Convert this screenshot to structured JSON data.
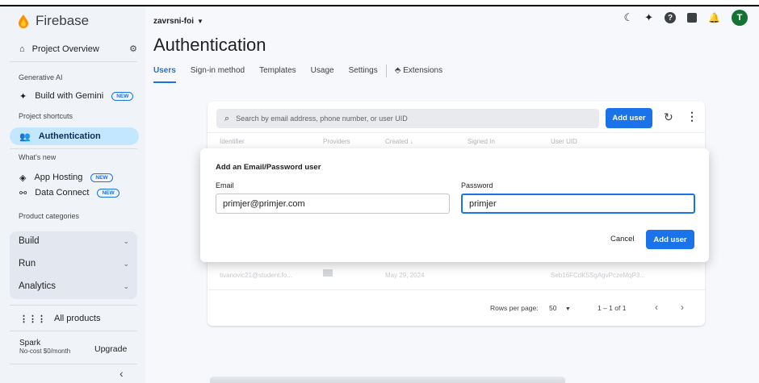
{
  "sidebar": {
    "brand": "Firebase",
    "project_overview": "Project Overview",
    "generative_ai_heading": "Generative AI",
    "build_with_gemini": "Build with Gemini",
    "new_badge": "NEW",
    "project_shortcuts_heading": "Project shortcuts",
    "authentication": "Authentication",
    "whats_new_heading": "What's new",
    "app_hosting": "App Hosting",
    "data_connect": "Data Connect",
    "product_categories_heading": "Product categories",
    "categories": [
      "Build",
      "Run",
      "Analytics"
    ],
    "all_products": "All products",
    "plan_name": "Spark",
    "plan_detail": "No-cost $0/month",
    "upgrade": "Upgrade",
    "collapse": "‹"
  },
  "header": {
    "project": "zavrsni-foi",
    "title": "Authentication",
    "tabs": [
      "Users",
      "Sign-in method",
      "Templates",
      "Usage",
      "Settings",
      "Extensions"
    ],
    "avatar_letter": "T"
  },
  "users": {
    "search_placeholder": "Search by email address, phone number, or user UID",
    "add_user": "Add user",
    "columns": [
      "Identifier",
      "Providers",
      "Created",
      "Signed In",
      "User UID"
    ],
    "created_arrow": "↓",
    "row": {
      "identifier": "tivanovic21@student.fo...",
      "created": "May 29, 2024",
      "uid": "Seb16FCdK5SgAgvPczeMqP3..."
    },
    "rows_per_page_label": "Rows per page:",
    "rows_per_page": "50",
    "range": "1 – 1 of 1"
  },
  "dialog": {
    "title": "Add an Email/Password user",
    "email_label": "Email",
    "email_value": "primjer@primjer.com",
    "password_label": "Password",
    "password_value": "primjer",
    "cancel": "Cancel",
    "add_user": "Add user"
  },
  "colors": {
    "accent": "#1a73e8",
    "active_nav": "#c2e7ff",
    "avatar": "#137333",
    "firebase_flame": "#ff8f00"
  }
}
